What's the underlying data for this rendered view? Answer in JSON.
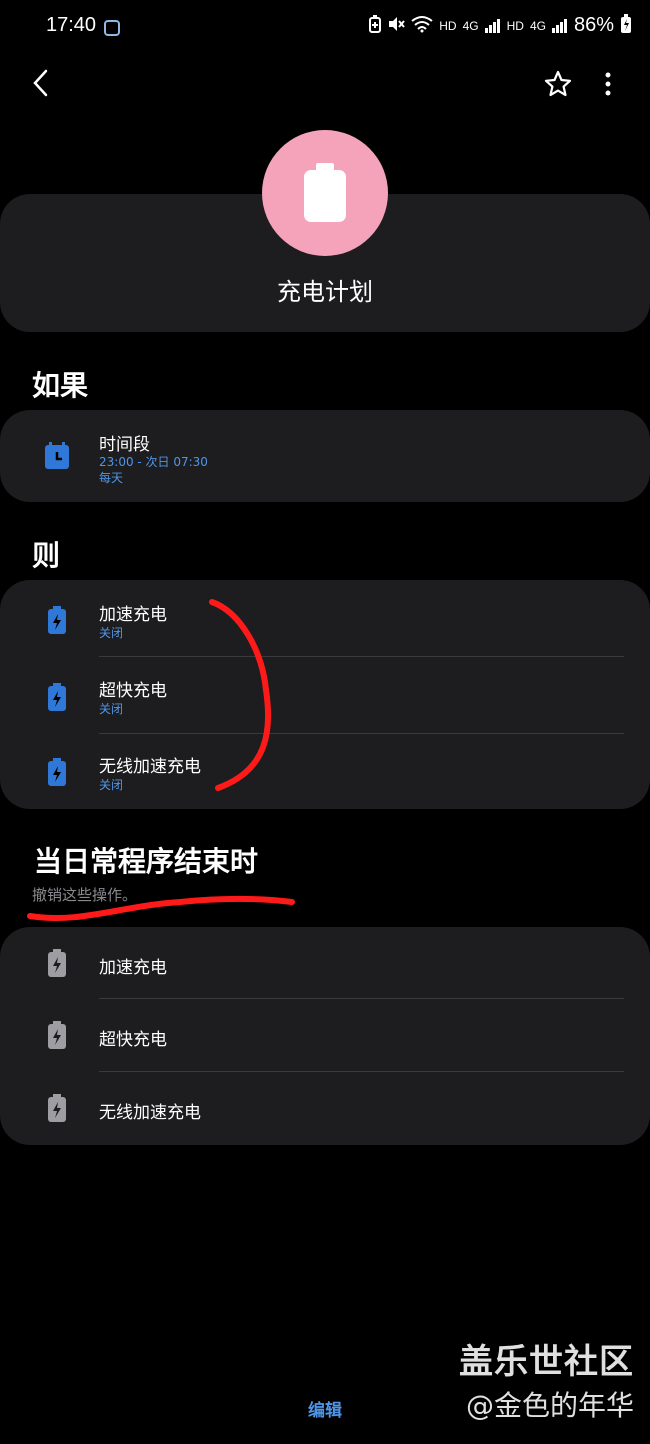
{
  "status_bar": {
    "time": "17:40",
    "indicators": [
      "HD",
      "4G",
      "HD",
      "4G"
    ],
    "battery_percent": "86%"
  },
  "header": {
    "title": "充电计划",
    "icon": "battery-icon",
    "icon_bg": "#f4a3bb"
  },
  "if_section": {
    "title": "如果",
    "items": [
      {
        "title": "时间段",
        "subtitle": "23:00 - 次日 07:30",
        "detail": "每天",
        "icon": "calendar-clock-icon"
      }
    ]
  },
  "then_section": {
    "title": "则",
    "items": [
      {
        "title": "加速充电",
        "subtitle": "关闭",
        "icon": "battery-bolt-icon"
      },
      {
        "title": "超快充电",
        "subtitle": "关闭",
        "icon": "battery-bolt-icon"
      },
      {
        "title": "无线加速充电",
        "subtitle": "关闭",
        "icon": "battery-bolt-icon"
      }
    ]
  },
  "end_section": {
    "title": "当日常程序结束时",
    "subtitle": "撤销这些操作。",
    "items": [
      {
        "title": "加速充电",
        "icon": "battery-bolt-icon"
      },
      {
        "title": "超快充电",
        "icon": "battery-bolt-icon"
      },
      {
        "title": "无线加速充电",
        "icon": "battery-bolt-icon"
      }
    ]
  },
  "footer": {
    "edit_label": "编辑"
  },
  "watermark": {
    "line1": "盖乐世社区",
    "line2": "@金色的年华"
  },
  "colors": {
    "accent": "#4f95e8",
    "card": "#1d1d1f",
    "annotation": "#ff1a1a"
  }
}
